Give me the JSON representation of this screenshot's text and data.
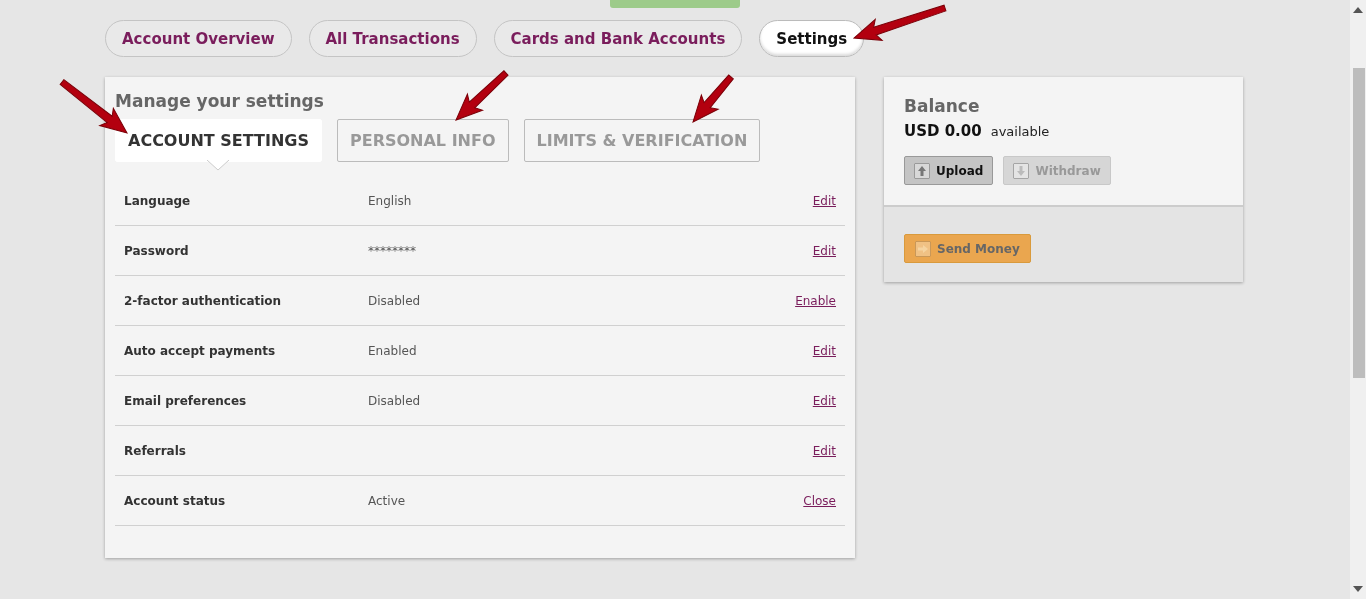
{
  "nav_tabs": [
    {
      "label": "Account Overview",
      "selected": false
    },
    {
      "label": "All Transactions",
      "selected": false
    },
    {
      "label": "Cards and Bank Accounts",
      "selected": false
    },
    {
      "label": "Settings",
      "selected": true
    }
  ],
  "settings_panel": {
    "title": "Manage your settings",
    "tabs": [
      {
        "label": "ACCOUNT SETTINGS",
        "selected": true
      },
      {
        "label": "PERSONAL INFO",
        "selected": false
      },
      {
        "label": "LIMITS & VERIFICATION",
        "selected": false
      }
    ],
    "rows": [
      {
        "label": "Language",
        "value": "English",
        "action": "Edit"
      },
      {
        "label": "Password",
        "value": "********",
        "action": "Edit"
      },
      {
        "label": "2-factor authentication",
        "value": "Disabled",
        "action": "Enable"
      },
      {
        "label": "Auto accept payments",
        "value": "Enabled",
        "action": "Edit"
      },
      {
        "label": "Email preferences",
        "value": "Disabled",
        "action": "Edit"
      },
      {
        "label": "Referrals",
        "action": "Edit"
      },
      {
        "label": "Account status",
        "value": "Active",
        "action": "Close"
      }
    ]
  },
  "balance": {
    "title": "Balance",
    "amount": "USD 0.00",
    "note": "available",
    "buttons": [
      {
        "label": "Upload",
        "kind": "upload",
        "disabled": false
      },
      {
        "label": "Withdraw",
        "kind": "withdraw",
        "disabled": true
      }
    ],
    "send_button": {
      "label": "Send Money"
    }
  }
}
